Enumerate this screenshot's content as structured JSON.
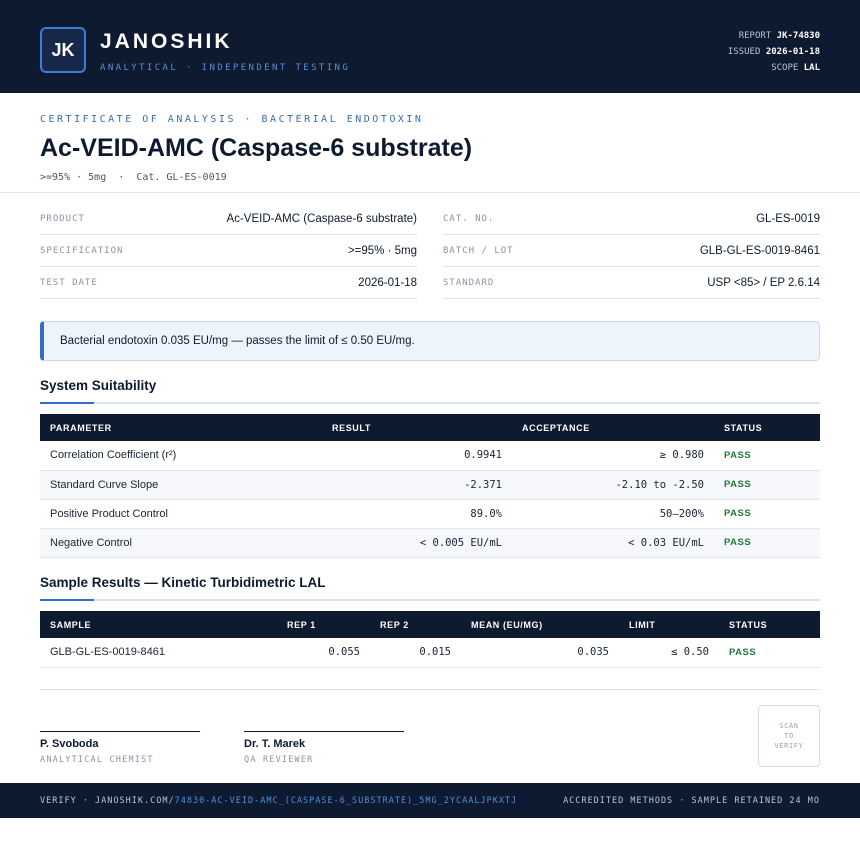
{
  "header": {
    "logo_text": "JK",
    "brand": "JANOSHIK",
    "tagline": "ANALYTICAL · INDEPENDENT TESTING",
    "report_label": "REPORT",
    "report_value": "JK-74830",
    "issued_label": "ISSUED",
    "issued_value": "2026-01-18",
    "scope_label": "SCOPE",
    "scope_value": "LAL"
  },
  "title_block": {
    "kicker": "CERTIFICATE OF ANALYSIS · BACTERIAL ENDOTOXIN",
    "title": "Ac-VEID-AMC (Caspase-6 substrate)",
    "subtitle": ">=95% · 5mg  ·  Cat. GL-ES-0019"
  },
  "info": {
    "left": [
      {
        "label": "PRODUCT",
        "value": "Ac-VEID-AMC (Caspase-6 substrate)"
      },
      {
        "label": "SPECIFICATION",
        "value": ">=95% · 5mg"
      },
      {
        "label": "TEST DATE",
        "value": "2026-01-18"
      }
    ],
    "right": [
      {
        "label": "CAT. NO.",
        "value": "GL-ES-0019"
      },
      {
        "label": "BATCH / LOT",
        "value": "GLB-GL-ES-0019-8461"
      },
      {
        "label": "STANDARD",
        "value": "USP <85> / EP 2.6.14"
      }
    ]
  },
  "callout": "Bacterial endotoxin 0.035 EU/mg — passes the limit of ≤ 0.50 EU/mg.",
  "suitability": {
    "title": "System Suitability",
    "columns": [
      "PARAMETER",
      "RESULT",
      "ACCEPTANCE",
      "STATUS"
    ],
    "rows": [
      {
        "parameter": "Correlation Coefficient (r²)",
        "result": "0.9941",
        "acceptance": "≥ 0.980",
        "status": "PASS"
      },
      {
        "parameter": "Standard Curve Slope",
        "result": "-2.371",
        "acceptance": "-2.10 to -2.50",
        "status": "PASS"
      },
      {
        "parameter": "Positive Product Control",
        "result": "89.0%",
        "acceptance": "50–200%",
        "status": "PASS"
      },
      {
        "parameter": "Negative Control",
        "result": "< 0.005 EU/mL",
        "acceptance": "< 0.03 EU/mL",
        "status": "PASS"
      }
    ]
  },
  "samples": {
    "title": "Sample Results — Kinetic Turbidimetric LAL",
    "columns": [
      "SAMPLE",
      "REP 1",
      "REP 2",
      "MEAN (EU/MG)",
      "LIMIT",
      "STATUS"
    ],
    "rows": [
      {
        "sample": "GLB-GL-ES-0019-8461",
        "rep1": "0.055",
        "rep2": "0.015",
        "mean": "0.035",
        "limit": "≤ 0.50",
        "status": "PASS"
      }
    ]
  },
  "signatures": [
    {
      "name": "P. Svoboda",
      "role": "ANALYTICAL CHEMIST"
    },
    {
      "name": "Dr. T. Marek",
      "role": "QA REVIEWER"
    }
  ],
  "qr": {
    "line1": "SCAN",
    "line2": "TO",
    "line3": "VERIFY"
  },
  "footer": {
    "verify_prefix": "VERIFY · JANOSHIK.COM/",
    "verify_link": "74830-AC-VEID-AMC_(CASPASE-6_SUBSTRATE)_5MG_2YCAALJPKXTJ",
    "right": "ACCREDITED METHODS · SAMPLE RETAINED 24 MO"
  },
  "colors": {
    "navy": "#0e1a2f",
    "accent": "#2f6fc7",
    "pass": "#1f7a3a"
  }
}
